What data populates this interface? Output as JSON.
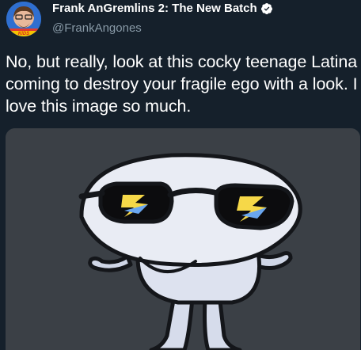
{
  "tweet": {
    "display_name": "Frank AnGremlins 2: The New Batch",
    "handle": "@FrankAngones",
    "verified_icon": "verified-badge-icon",
    "text": "No, but really, look at this cocky teenage Latina coming to destroy your fragile ego with a look. I love this image so much.",
    "avatar_badge_text": "KIDS"
  },
  "colors": {
    "background": "#15202b",
    "secondary_text": "#8899a6",
    "verified": "#ffffff",
    "media_background": "#3b4046"
  }
}
